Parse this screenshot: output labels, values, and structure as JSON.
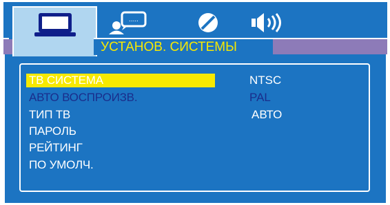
{
  "tabs": [
    {
      "icon": "tv-icon",
      "active": true
    },
    {
      "icon": "user-remote-icon",
      "active": false
    },
    {
      "icon": "disc-icon",
      "active": false
    },
    {
      "icon": "speaker-icon",
      "active": false
    }
  ],
  "title": "УСТАНОВ. СИСТЕМЫ",
  "menu": [
    "ТВ СИСТЕМА",
    "АВТО ВОСПРОИЗВ.",
    "ТИП ТВ",
    "ПАРОЛЬ",
    "РЕЙТИНГ",
    "ПО УМОЛЧ."
  ],
  "options": [
    "NTSC",
    "PAL",
    "АВТО"
  ],
  "colors": {
    "background": "#1c74c2",
    "highlight": "#f7e900",
    "title_text": "#f7e900",
    "dim_text": "#1a2e8c",
    "title_band": "#8d7bb8"
  }
}
